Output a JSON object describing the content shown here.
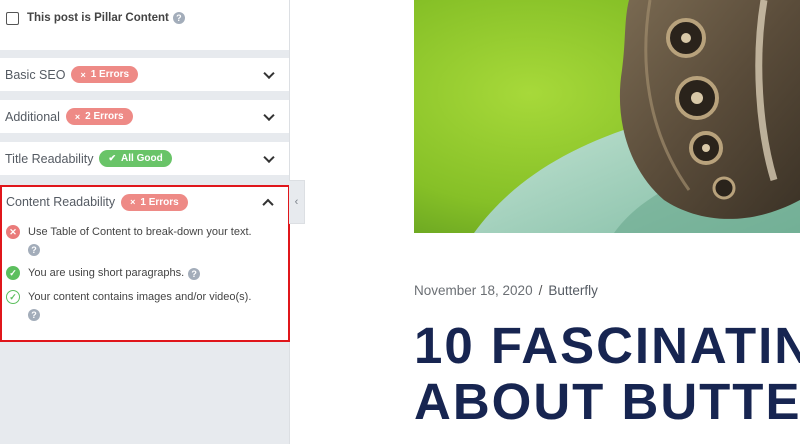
{
  "sidebar": {
    "pillar_label": "This post is Pillar Content",
    "sections": [
      {
        "label": "Basic SEO",
        "badge": "1 Errors",
        "badge_icon": "×",
        "status": "error"
      },
      {
        "label": "Additional",
        "badge": "2 Errors",
        "badge_icon": "×",
        "status": "error"
      },
      {
        "label": "Title Readability",
        "badge": "All Good",
        "badge_icon": "✔",
        "status": "ok"
      }
    ],
    "content_readability": {
      "label": "Content Readability",
      "badge": "1 Errors",
      "badge_icon": "×",
      "checks": [
        {
          "text": "Use Table of Content to break-down your text.",
          "status": "fail"
        },
        {
          "text": "You are using short paragraphs.",
          "status": "pass"
        },
        {
          "text": "Your content contains images and/or video(s).",
          "status": "pass"
        }
      ]
    },
    "help_glyph": "?",
    "collapse_glyph": "‹"
  },
  "article": {
    "date": "November 18, 2020",
    "separator": "/",
    "category": "Butterfly",
    "title_line1": "10 FASCINATIN",
    "title_line2": "ABOUT BUTTE"
  },
  "colors": {
    "error_badge": "#ee8a86",
    "ok_badge": "#69c468",
    "highlight_border": "#e0161b",
    "title": "#172551"
  }
}
